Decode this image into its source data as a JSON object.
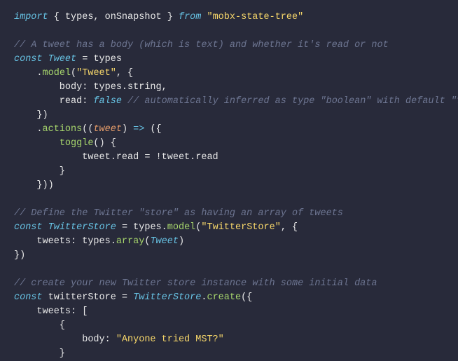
{
  "code": {
    "l1_kw1": "import",
    "l1_imp": "{ types, onSnapshot }",
    "l1_kw2": "from",
    "l1_str": "\"mobx-state-tree\"",
    "l3_comment": "// A tweet has a body (which is text) and whether it's read or not",
    "l4_kw": "const",
    "l4_cls": "Tweet",
    "l4_rest": " = types",
    "l5_a": "    .",
    "l5_fn": "model",
    "l5_b": "(",
    "l5_str": "\"Tweet\"",
    "l5_c": ", {",
    "l6_a": "        body: types.string,",
    "l7_a": "        read: ",
    "l7_lit": "false",
    "l7_b": " ",
    "l7_comment": "// automatically inferred as type \"boolean\" with default \"false\"",
    "l8": "    })",
    "l9_a": "    .",
    "l9_fn": "actions",
    "l9_b": "((",
    "l9_param": "tweet",
    "l9_c": ") ",
    "l9_arrow": "=>",
    "l9_d": " ({",
    "l10_a": "        ",
    "l10_fn": "toggle",
    "l10_b": "() {",
    "l11": "            tweet.read = !tweet.read",
    "l12": "        }",
    "l13": "    }))",
    "l15_comment": "// Define the Twitter \"store\" as having an array of tweets",
    "l16_kw": "const",
    "l16_cls": "TwitterStore",
    "l16_a": " = types.",
    "l16_fn": "model",
    "l16_b": "(",
    "l16_str": "\"TwitterStore\"",
    "l16_c": ", {",
    "l17_a": "    tweets: types.",
    "l17_fn": "array",
    "l17_b": "(",
    "l17_cls": "Tweet",
    "l17_c": ")",
    "l18": "})",
    "l20_comment": "// create your new Twitter store instance with some initial data",
    "l21_kw": "const",
    "l21_id": " twitterStore = ",
    "l21_cls": "TwitterStore",
    "l21_a": ".",
    "l21_fn": "create",
    "l21_b": "({",
    "l22": "    tweets: [",
    "l23": "        {",
    "l24_a": "            body: ",
    "l24_str": "\"Anyone tried MST?\"",
    "l25": "        }"
  }
}
